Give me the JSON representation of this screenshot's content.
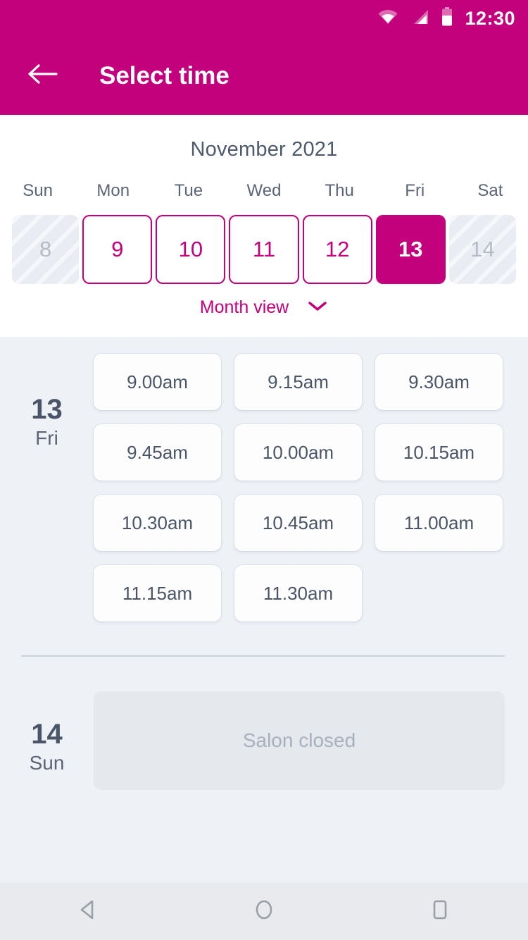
{
  "statusbar": {
    "time": "12:30",
    "icons": [
      "wifi-icon",
      "signal-icon",
      "battery-icon"
    ]
  },
  "appbar": {
    "title": "Select time",
    "back_icon": "back-arrow-icon",
    "background_color": "#c4017c"
  },
  "calendar": {
    "month_title": "November 2021",
    "weekday_headers": [
      "Sun",
      "Mon",
      "Tue",
      "Wed",
      "Thu",
      "Fri",
      "Sat"
    ],
    "days": [
      {
        "number": "8",
        "state": "disabled"
      },
      {
        "number": "9",
        "state": "enabled"
      },
      {
        "number": "10",
        "state": "enabled"
      },
      {
        "number": "11",
        "state": "enabled"
      },
      {
        "number": "12",
        "state": "enabled"
      },
      {
        "number": "13",
        "state": "selected"
      },
      {
        "number": "14",
        "state": "disabled"
      }
    ],
    "view_toggle": {
      "label": "Month view",
      "icon": "chevron-down-icon"
    },
    "accent_color": "#c4017c"
  },
  "schedule": {
    "groups": [
      {
        "day_number": "13",
        "day_name": "Fri",
        "slots": [
          "9.00am",
          "9.15am",
          "9.30am",
          "9.45am",
          "10.00am",
          "10.15am",
          "10.30am",
          "10.45am",
          "11.00am",
          "11.15am",
          "11.30am"
        ]
      },
      {
        "day_number": "14",
        "day_name": "Sun",
        "closed_message": "Salon closed"
      }
    ]
  },
  "navbar": {
    "back_label": "back-nav-icon",
    "home_label": "home-nav-icon",
    "recents_label": "recents-nav-icon"
  }
}
